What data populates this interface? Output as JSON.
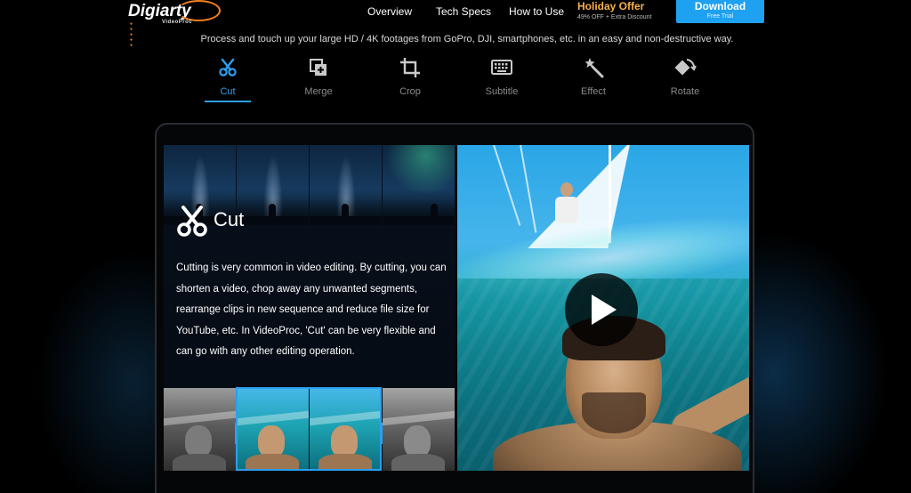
{
  "header": {
    "logo": {
      "brand": "Digiarty",
      "product": "VideoProc"
    },
    "nav": [
      {
        "label": "Overview"
      },
      {
        "label": "Tech Specs"
      },
      {
        "label": "How to Use"
      }
    ],
    "promo": {
      "title": "Holiday Offer",
      "subtitle": "49% OFF + Extra Discount"
    },
    "download": {
      "label": "Download",
      "sublabel": "Free Trial"
    }
  },
  "tagline": "Process and touch up your large HD / 4K footages from GoPro, DJI, smartphones, etc. in an easy and non-destructive way.",
  "features": {
    "active": "Cut",
    "tabs": [
      {
        "label": "Cut",
        "icon": "scissors-icon"
      },
      {
        "label": "Merge",
        "icon": "merge-icon"
      },
      {
        "label": "Crop",
        "icon": "crop-icon"
      },
      {
        "label": "Subtitle",
        "icon": "keyboard-icon"
      },
      {
        "label": "Effect",
        "icon": "magic-wand-icon"
      },
      {
        "label": "Rotate",
        "icon": "rotate-icon"
      }
    ]
  },
  "panel": {
    "title": "Cut",
    "description": "Cutting is very common in video editing. By cutting, you can shorten a video, chop away any unwanted segments, rearrange clips in new sequence and reduce file size for YouTube, etc. In VideoProc, 'Cut' can be very flexible and can go with any other editing operation."
  },
  "video": {
    "play_icon": "play-icon"
  },
  "colors": {
    "accent": "#2b9ff0",
    "download": "#1fa1f1",
    "promo": "#f5b04a",
    "logo_ring": "#f58220"
  }
}
